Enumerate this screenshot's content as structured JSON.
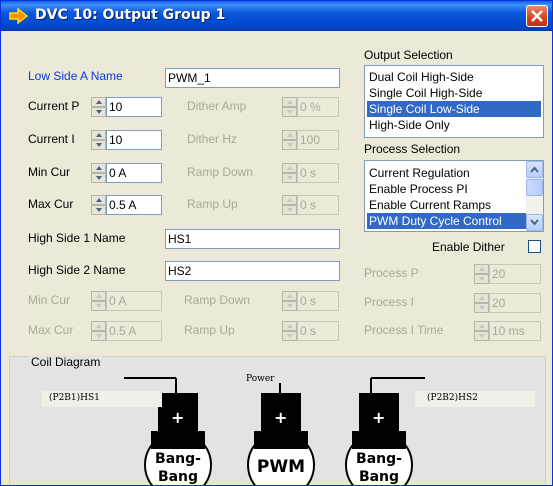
{
  "window": {
    "title": "DVC 10: Output Group 1"
  },
  "low_side_a": {
    "label": "Low Side A Name",
    "value": "PWM_1"
  },
  "current_p": {
    "label": "Current P",
    "value": "10"
  },
  "current_i": {
    "label": "Current I",
    "value": "10"
  },
  "min_cur": {
    "label": "Min Cur",
    "value": "0 A"
  },
  "max_cur": {
    "label": "Max Cur",
    "value": "0.5 A"
  },
  "dither_amp": {
    "label": "Dither Amp",
    "value": "0 %"
  },
  "dither_hz": {
    "label": "Dither Hz",
    "value": "100"
  },
  "ramp_down": {
    "label": "Ramp Down",
    "value": "0 s"
  },
  "ramp_up": {
    "label": "Ramp Up",
    "value": "0 s"
  },
  "high_side_1": {
    "label": "High Side 1 Name",
    "value": "HS1"
  },
  "high_side_2": {
    "label": "High Side 2 Name",
    "value": "HS2"
  },
  "hs_min_cur": {
    "label": "Min Cur",
    "value": "0 A"
  },
  "hs_max_cur": {
    "label": "Max Cur",
    "value": "0.5 A"
  },
  "hs_ramp_down": {
    "label": "Ramp Down",
    "value": "0 s"
  },
  "hs_ramp_up": {
    "label": "Ramp Up",
    "value": "0 s"
  },
  "output_selection": {
    "label": "Output Selection",
    "items": [
      "Dual Coil High-Side",
      "Single Coil High-Side",
      "Single Coil Low-Side",
      "High-Side Only"
    ],
    "selected": "Single Coil Low-Side"
  },
  "process_selection": {
    "label": "Process Selection",
    "items": [
      "Current Regulation",
      "Enable Process PI",
      "Enable Current Ramps",
      "PWM Duty Cycle Control"
    ],
    "selected": "PWM Duty Cycle Control"
  },
  "enable_dither": {
    "label": "Enable Dither",
    "checked": false
  },
  "process_p": {
    "label": "Process P",
    "value": "20"
  },
  "process_i": {
    "label": "Process I",
    "value": "20"
  },
  "process_i_time": {
    "label": "Process I Time",
    "value": "10 ms"
  },
  "coil_diagram": {
    "label": "Coil Diagram",
    "left_tag": "(P2B1)HS1",
    "right_tag": "(P2B2)HS2",
    "power_label": "Power",
    "coils": [
      {
        "line1": "Bang-",
        "line2": "Bang"
      },
      {
        "line1": "PWM",
        "line2": ""
      },
      {
        "line1": "Bang-",
        "line2": "Bang"
      }
    ],
    "plus": "+"
  },
  "colors": {
    "title_bar": "#0a57dc",
    "selection": "#316ac5",
    "label_blue": "#0b3cd6",
    "disabled_text": "#aca899"
  }
}
